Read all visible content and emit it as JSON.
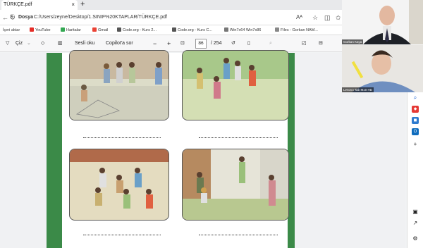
{
  "tab": {
    "title": "TÜRKÇE.pdf",
    "close": "×"
  },
  "new_tab": "+",
  "address": {
    "label": "Dosya",
    "url": "C:/Users/zeyne/Desktop/1.SINIF%20KTAPLAR/TÜRKÇE.pdf"
  },
  "favorites": [
    {
      "label": "İçeri aktar",
      "color": "#666"
    },
    {
      "label": "YouTube",
      "color": "#e52d27"
    },
    {
      "label": "Haritalar",
      "color": "#34a853"
    },
    {
      "label": "Gmail",
      "color": "#ea4335"
    },
    {
      "label": "Code.org - Kurs 2...",
      "color": "#555"
    },
    {
      "label": "Code.org - Kurs C...",
      "color": "#555"
    },
    {
      "label": "Win7x64 Win7x86",
      "color": "#777"
    },
    {
      "label": "Files - Gorkan NAM...",
      "color": "#888"
    }
  ],
  "pdf_toolbar": {
    "draw_label": "Çiz",
    "read_aloud": "Sesli oku",
    "copilot": "Copilot'a sor",
    "minus": "−",
    "plus": "+",
    "page_current": "86",
    "page_total": "/ 254"
  },
  "participants": [
    {
      "name": "Gorkan Kaya"
    },
    {
      "name": "Lenovo Tab M10 HD"
    }
  ],
  "colors": {
    "green_border": "#3b8a48",
    "accent": "#0b57d0"
  }
}
